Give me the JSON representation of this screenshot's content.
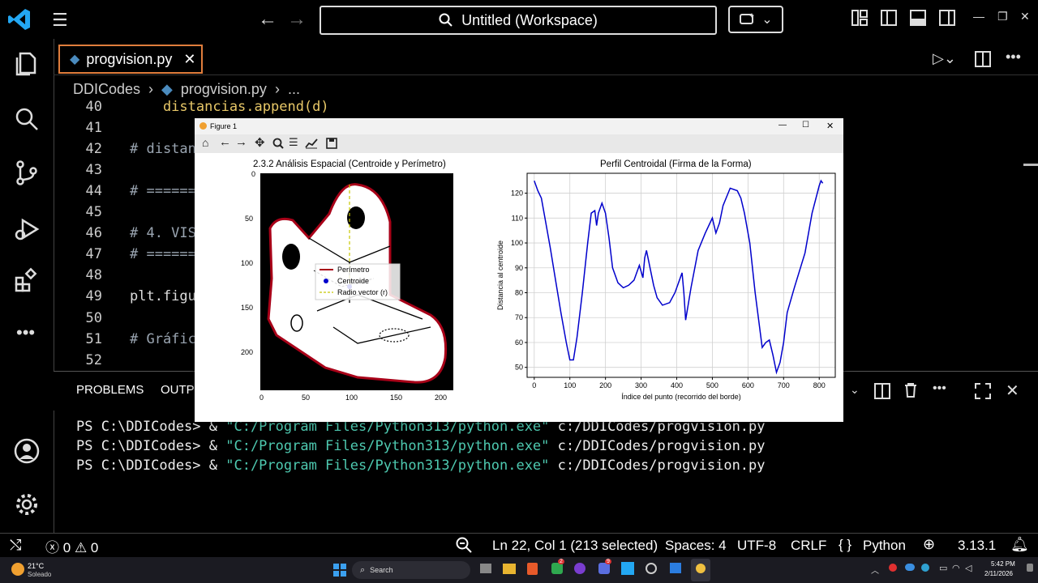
{
  "titlebar": {
    "search_text": "Untitled (Workspace)"
  },
  "tab": {
    "filename": "progvision.py"
  },
  "breadcrumb": {
    "folder": "DDICodes",
    "file": "progvision.py",
    "more": "..."
  },
  "editor": {
    "lines": [
      {
        "num": "40",
        "text": "    distancias.append(d)"
      },
      {
        "num": "41",
        "text": ""
      },
      {
        "num": "42",
        "text": "# distan"
      },
      {
        "num": "43",
        "text": ""
      },
      {
        "num": "44",
        "text": "# ======"
      },
      {
        "num": "45",
        "text": ""
      },
      {
        "num": "46",
        "text": "# 4. VIS"
      },
      {
        "num": "47",
        "text": "# ======"
      },
      {
        "num": "48",
        "text": ""
      },
      {
        "num": "49",
        "text": "plt.figu"
      },
      {
        "num": "50",
        "text": ""
      },
      {
        "num": "51",
        "text": "# Gráfic"
      },
      {
        "num": "52",
        "text": ""
      }
    ]
  },
  "panel": {
    "tab_problems": "PROBLEMS",
    "tab_output": "OUTP"
  },
  "terminal": {
    "lines": [
      {
        "prompt": "PS C:\\DDICodes> & ",
        "str": "\"C:/Program Files/Python313/python.exe\"",
        "arg": " c:/DDICodes/progvision.py"
      },
      {
        "prompt": "PS C:\\DDICodes> & ",
        "str": "\"C:/Program Files/Python313/python.exe\"",
        "arg": " c:/DDICodes/progvision.py"
      },
      {
        "prompt": "PS C:\\DDICodes> & ",
        "str": "\"C:/Program Files/Python313/python.exe\"",
        "arg": " c:/DDICodes/progvision.py"
      }
    ]
  },
  "statusbar": {
    "errors": "0",
    "warnings": "0",
    "position": "Ln 22, Col 1 (213 selected)",
    "spaces": "Spaces: 4",
    "encoding": "UTF-8",
    "eol": "CRLF",
    "language": "Python",
    "version": "3.13.1"
  },
  "taskbar": {
    "temp": "21°C",
    "weather": "Soleado",
    "search": "Search",
    "time": "5:42 PM",
    "date": "2/11/2026",
    "badge_a": "2",
    "badge_b": "9"
  },
  "figure": {
    "title": "Figure 1",
    "left_title": "2.3.2 Análisis Espacial (Centroide y Perímetro)",
    "legend": [
      "Perímetro",
      "Centroide",
      "Radio vector (r)"
    ],
    "left_xticks": [
      "0",
      "50",
      "100",
      "150",
      "200"
    ],
    "left_yticks": [
      "0",
      "50",
      "100",
      "150",
      "200"
    ]
  },
  "chart_data": {
    "type": "line",
    "title": "Perfil Centroidal (Firma de la Forma)",
    "xlabel": "Índice del punto (recorrido del borde)",
    "ylabel": "Distancia al centroide",
    "xlim": [
      -20,
      845
    ],
    "ylim": [
      46,
      128
    ],
    "xticks": [
      0,
      100,
      200,
      300,
      400,
      500,
      600,
      700,
      800
    ],
    "yticks": [
      50,
      60,
      70,
      80,
      90,
      100,
      110,
      120
    ],
    "grid": true,
    "series": [
      {
        "color": "#0000cc",
        "x": [
          0,
          10,
          20,
          30,
          45,
          60,
          75,
          90,
          100,
          110,
          120,
          135,
          150,
          160,
          170,
          175,
          180,
          190,
          200,
          210,
          220,
          235,
          250,
          265,
          280,
          295,
          305,
          310,
          315,
          325,
          335,
          345,
          360,
          380,
          395,
          405,
          415,
          420,
          425,
          440,
          460,
          480,
          500,
          510,
          520,
          530,
          550,
          570,
          580,
          590,
          605,
          620,
          640,
          650,
          660,
          670,
          680,
          690,
          695,
          700,
          710,
          730,
          760,
          780,
          800,
          805,
          810
        ],
        "y": [
          125,
          121,
          118,
          110,
          98,
          85,
          72,
          60,
          53,
          53,
          62,
          80,
          100,
          112,
          113,
          107,
          112,
          116,
          112,
          102,
          90,
          84,
          82,
          83,
          85,
          91,
          86,
          94,
          97,
          90,
          83,
          78,
          75,
          76,
          80,
          84,
          88,
          80,
          69,
          82,
          97,
          104,
          110,
          104,
          108,
          115,
          122,
          121,
          118,
          112,
          100,
          80,
          58,
          60,
          61,
          55,
          48,
          52,
          56,
          60,
          72,
          82,
          96,
          112,
          123,
          125,
          124
        ]
      }
    ]
  }
}
